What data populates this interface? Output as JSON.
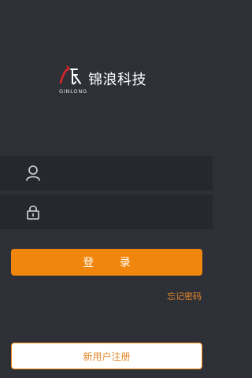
{
  "logo": {
    "name": "锦浪科技",
    "subtitle": "GINLONG"
  },
  "login_form": {
    "username_placeholder": "",
    "password_placeholder": "",
    "login_label": "登 录",
    "forgot_label": "忘记密码",
    "register_label": "新用户注册",
    "icons": {
      "username": "user-icon",
      "password": "lock-icon"
    }
  },
  "colors": {
    "background": "#2e3038",
    "field_background": "#262830",
    "accent": "#f0860d"
  }
}
